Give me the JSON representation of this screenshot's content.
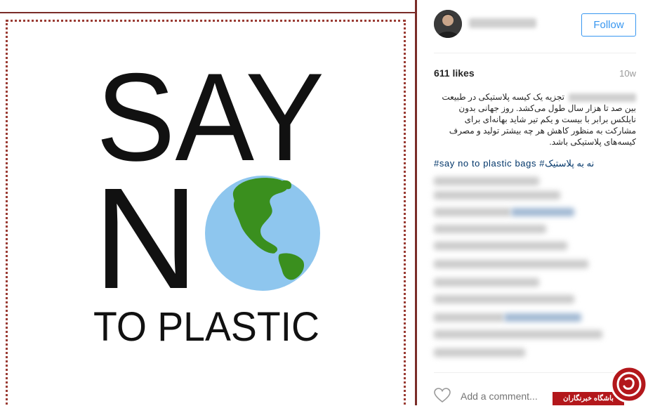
{
  "post": {
    "image": {
      "word_say": "SAY",
      "word_n": "N",
      "word_to_plastic": "TO PLASTIC",
      "ocean_color": "#8ec6ee",
      "land_color": "#3a8f1e"
    }
  },
  "panel": {
    "username": "ahmad1992",
    "follow_label": "Follow",
    "likes": "611 likes",
    "age": "10w",
    "caption_user": "user_hidden",
    "caption_text": "تجزیه یک کیسه پلاستیکی در طبیعت بین صد تا هزار سال طول می‌کشد. روز جهانی بدون نایلکس برابر با بیست و یکم تیر شاید بهانه‌ای برای مشارکت به منظور کاهش هر چه بیشتر تولید و مصرف کیسه‌های پلاستیکی باشد.",
    "hashtags": "#say no to plastic bags #نه به پلاستیک",
    "comment_placeholder": "Add a comment...",
    "accent_color": "#3897f0"
  },
  "watermark": {
    "text": "باشگاه خبرنگاران"
  }
}
